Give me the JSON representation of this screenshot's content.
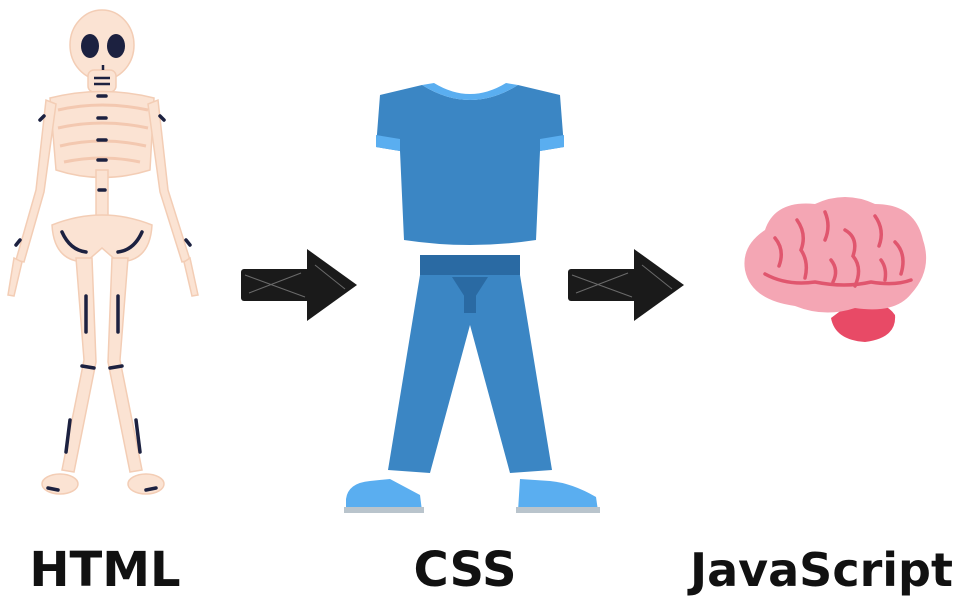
{
  "labels": {
    "html": "HTML",
    "css": "CSS",
    "javascript": "JavaScript"
  },
  "colors": {
    "bone": "#fbe3d3",
    "bone_joint": "#1c2140",
    "shirt": "#3b86c4",
    "shirt_trim": "#5aaef0",
    "pants": "#3b86c4",
    "pants_dark": "#2a6aa3",
    "shoes": "#5aaef0",
    "brain": "#f4a6b4",
    "brain_lines": "#e0566e",
    "brain_stem": "#e84a66",
    "arrow": "#1a1a1a",
    "text": "#111111"
  }
}
